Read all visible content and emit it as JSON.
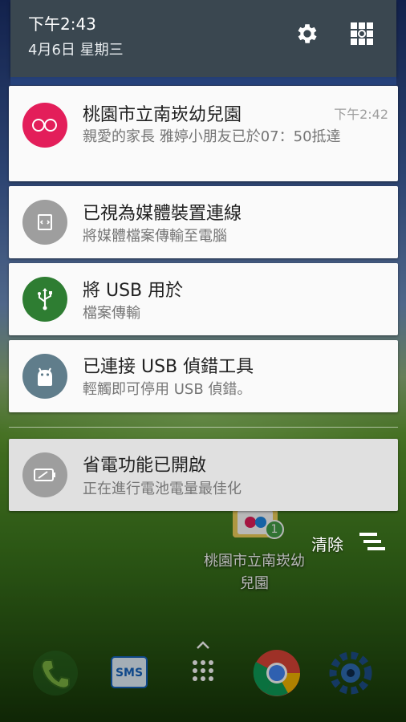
{
  "header": {
    "time": "下午2:43",
    "date": "4月6日 星期三",
    "settings_icon": "gear-icon",
    "edit_icon": "quick-settings-grid-icon"
  },
  "notifications": [
    {
      "app_icon": "kindergarten-app-icon",
      "icon_color": "#e31e5a",
      "title": "桃園市立南崁幼兒園",
      "text": "親愛的家長 雅婷小朋友已於07：50抵達",
      "time": "下午2:42"
    },
    {
      "app_icon": "media-device-icon",
      "icon_color": "#9e9e9e",
      "title": "已視為媒體裝置連線",
      "text": "將媒體檔案傳輸至電腦"
    },
    {
      "app_icon": "usb-icon",
      "icon_color": "#2e7d32",
      "title": "將 USB 用於",
      "text": "檔案傳輸"
    },
    {
      "app_icon": "android-debug-icon",
      "icon_color": "#607d8b",
      "title": "已連接 USB 偵錯工具",
      "text": "輕觸即可停用 USB 偵錯。"
    },
    {
      "app_icon": "battery-saver-icon",
      "icon_color": "#9e9e9e",
      "title": "省電功能已開啟",
      "text": "正在進行電池電量最佳化"
    }
  ],
  "clear_all": {
    "label": "清除",
    "icon": "clear-all-icon"
  },
  "home": {
    "app_label": "桃園市立南崁幼兒園",
    "badge_count": "1",
    "dock": [
      "phone-icon",
      "sms-icon",
      "app-drawer-icon",
      "chrome-icon",
      "settings-icon"
    ]
  }
}
